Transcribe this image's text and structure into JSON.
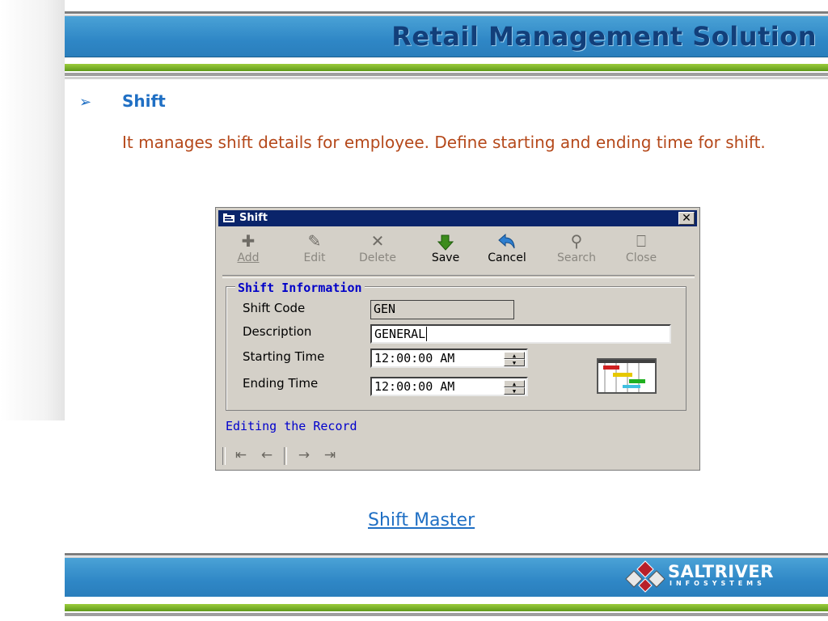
{
  "header": {
    "title": "Retail Management Solution"
  },
  "section": {
    "bullet": "➢",
    "heading": "Shift",
    "description": "It manages shift details for employee. Define starting and ending time for shift."
  },
  "dialog": {
    "title": "Shift",
    "close_glyph": "✕",
    "toolbar": [
      {
        "label": "Add",
        "icon": "plus-icon",
        "enabled": false
      },
      {
        "label": "Edit",
        "icon": "edit-icon",
        "enabled": false
      },
      {
        "label": "Delete",
        "icon": "delete-icon",
        "enabled": false
      },
      {
        "label": "Save",
        "icon": "save-arrow-icon",
        "enabled": true
      },
      {
        "label": "Cancel",
        "icon": "cancel-arrow-icon",
        "enabled": true
      },
      {
        "label": "Search",
        "icon": "search-icon",
        "enabled": false
      },
      {
        "label": "Close",
        "icon": "door-icon",
        "enabled": false
      }
    ],
    "group_title": "Shift Information",
    "fields": {
      "shift_code_label": "Shift Code",
      "shift_code_value": "GEN",
      "description_label": "Description",
      "description_value": "GENERAL",
      "start_label": "Starting Time",
      "start_value": "12:00:00 AM",
      "end_label": "Ending Time",
      "end_value": "12:00:00 AM"
    },
    "status": "Editing the Record",
    "nav": {
      "first": "⇤",
      "prev": "←",
      "next": "→",
      "last": "⇥"
    }
  },
  "caption": "Shift Master",
  "footer": {
    "logo_name": "SALTRIVER",
    "logo_sub": "INFOSYSTEMS"
  },
  "colors": {
    "header_blue": "#2f87c6",
    "header_text": "#123f7a",
    "accent_green": "#7cb52a",
    "heading_blue": "#1f6fc4",
    "body_text": "#b5491b",
    "dialog_title": "#0a246a"
  }
}
